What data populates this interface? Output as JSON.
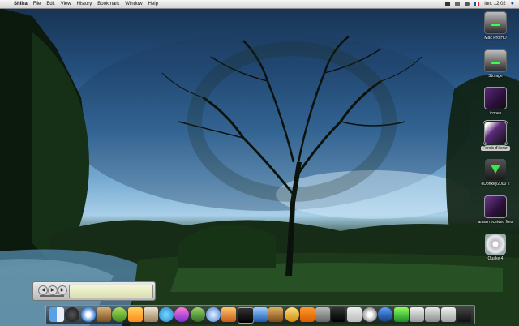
{
  "menubar": {
    "apple_glyph": "",
    "menus": [
      "Shiira",
      "File",
      "Edit",
      "View",
      "History",
      "Bookmark",
      "Window",
      "Help"
    ],
    "clock": "lun. 12:02"
  },
  "desktop_icons": [
    {
      "name": "mac-pro-hd",
      "label": "Mac Pro HD"
    },
    {
      "name": "storage",
      "label": "Storage"
    },
    {
      "name": "icones",
      "label": "icones"
    },
    {
      "name": "fonds-ecran",
      "label": "Fonds d'écran"
    },
    {
      "name": "edonkey",
      "label": "eDonkey2000 2"
    },
    {
      "name": "amsn-received",
      "label": "amsn received files"
    },
    {
      "name": "quake-4",
      "label": "Quake 4"
    }
  ],
  "player": {
    "display_glyph": ""
  },
  "dock_icons": [
    "finder-icon",
    "dashboard-icon",
    "safari-icon",
    "rabbit-app-icon",
    "green-app-icon",
    "adium-icon",
    "pointer-app-icon",
    "skype-icon",
    "photo-app-icon",
    "plant-app-icon",
    "itunes-icon",
    "photo-booth-icon",
    "imovie-icon",
    "iphoto-icon",
    "garageband-icon",
    "idvd-icon",
    "vlc-icon",
    "preview-icon",
    "quicktime-icon",
    "ipod-icon",
    "disc-utility-icon",
    "network-icon",
    "green-cube-icon",
    "window-icon",
    "photo-stack-icon",
    "documents-stack-icon",
    "trash-icon"
  ]
}
